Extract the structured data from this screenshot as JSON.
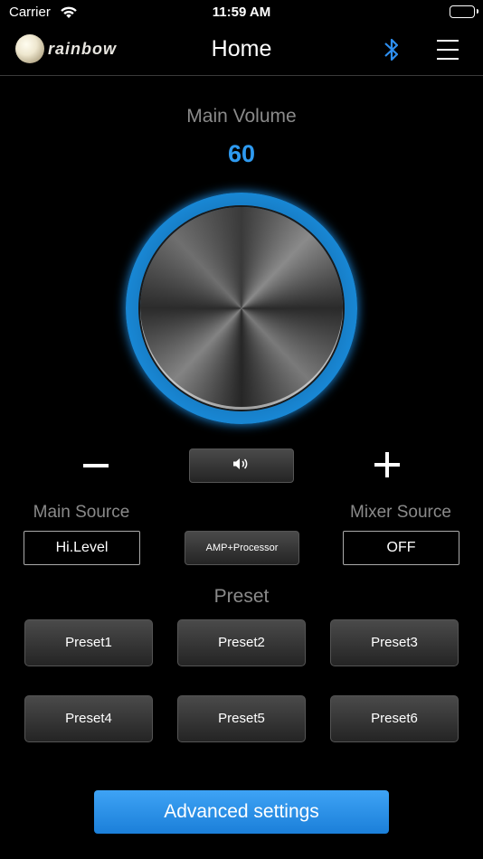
{
  "status_bar": {
    "carrier": "Carrier",
    "time": "11:59 AM"
  },
  "nav": {
    "logo_text": "rainbow",
    "title": "Home"
  },
  "volume": {
    "label": "Main Volume",
    "value": "60"
  },
  "sources": {
    "main_label": "Main Source",
    "main_value": "Hi.Level",
    "center_button": "AMP+Processor",
    "mixer_label": "Mixer Source",
    "mixer_value": "OFF"
  },
  "preset": {
    "label": "Preset",
    "items": [
      "Preset1",
      "Preset2",
      "Preset3",
      "Preset4",
      "Preset5",
      "Preset6"
    ]
  },
  "advanced_button": "Advanced settings",
  "colors": {
    "accent": "#2e9af0",
    "background": "#000000"
  },
  "icons": [
    "wifi-icon",
    "battery-icon",
    "bluetooth-icon",
    "menu-icon",
    "speaker-icon"
  ]
}
